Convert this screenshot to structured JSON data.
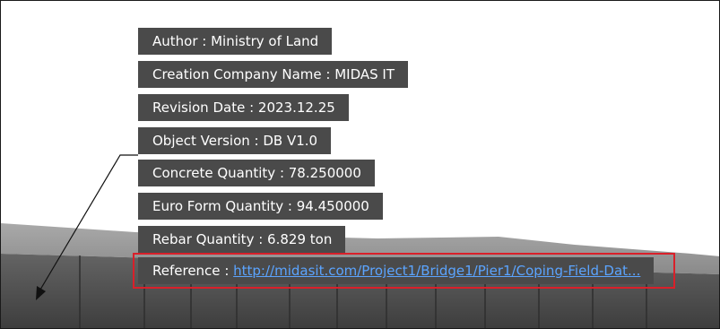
{
  "properties": [
    {
      "label": "Author",
      "value": "Ministry of Land"
    },
    {
      "label": "Creation Company Name",
      "value": "MIDAS IT"
    },
    {
      "label": "Revision Date",
      "value": "2023.12.25"
    },
    {
      "label": "Object Version",
      "value": "DB V1.0"
    },
    {
      "label": "Concrete Quantity",
      "value": "78.250000"
    },
    {
      "label": "Euro Form Quantity",
      "value": "94.450000"
    },
    {
      "label": "Rebar Quantity",
      "value": "6.829 ton"
    }
  ],
  "reference": {
    "label": "Reference",
    "link_text": "http://midasit.com/Project1/Bridge1/Pier1/Coping-Field-Dat..."
  },
  "colors": {
    "tooltip_bg": "#4a4a4a",
    "link": "#5ba4ff",
    "highlight_border": "#d9202a"
  },
  "icons": {
    "leader": "leader-line-arrow"
  }
}
